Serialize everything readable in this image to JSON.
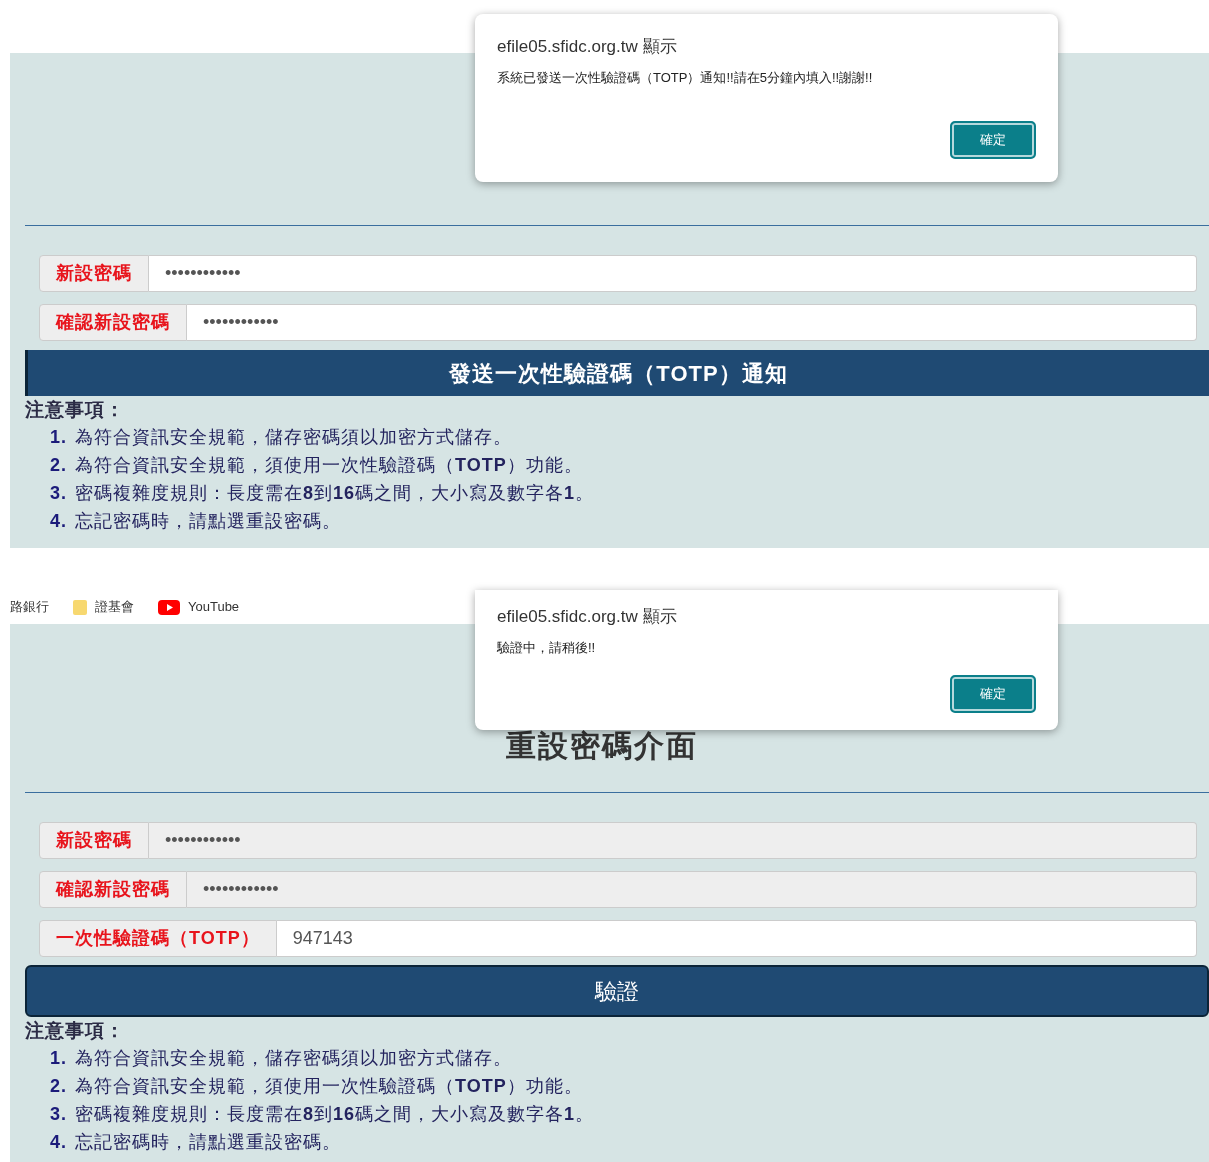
{
  "screenshots": [
    {
      "dialog": {
        "origin": "efile05.sfidc.org.tw 顯示",
        "message": "系統已發送一次性驗證碼（TOTP）通知!!請在5分鐘內填入!!謝謝!!",
        "ok_button": "確定"
      },
      "fields": [
        {
          "label": "新設密碼",
          "value": "••••••••••••",
          "disabled": false
        },
        {
          "label": "確認新設密碼",
          "value": "••••••••••••",
          "disabled": false
        }
      ],
      "action_button": {
        "kind": "send",
        "label": "發送一次性驗證碼（TOTP）通知"
      },
      "notes": {
        "heading": "注意事項：",
        "items": [
          {
            "number": "1.",
            "text": "為符合資訊安全規範，儲存密碼須以加密方式儲存。"
          },
          {
            "number": "2.",
            "text": "為符合資訊安全規範，須使用一次性驗證碼（**TOTP**）功能。"
          },
          {
            "number": "3.",
            "text": "密碼複雜度規則：長度需在**8**到**16**碼之間，大小寫及數字各**1**。"
          },
          {
            "number": "4.",
            "text": "忘記密碼時，請點選重設密碼。"
          }
        ]
      }
    },
    {
      "bookmarks": [
        {
          "kind": "text",
          "label": "路銀行"
        },
        {
          "kind": "folder",
          "label": "證基會"
        },
        {
          "kind": "youtube",
          "label": "YouTube"
        }
      ],
      "dialog": {
        "origin": "efile05.sfidc.org.tw 顯示",
        "message": "驗證中，請稍後!!",
        "ok_button": "確定"
      },
      "title": "重設密碼介面",
      "fields": [
        {
          "label": "新設密碼",
          "value": "••••••••••••",
          "disabled": true
        },
        {
          "label": "確認新設密碼",
          "value": "••••••••••••",
          "disabled": true
        },
        {
          "label": "一次性驗證碼（TOTP）",
          "value": "947143",
          "disabled": false
        }
      ],
      "action_button": {
        "kind": "verify",
        "label": "驗證"
      },
      "notes": {
        "heading": "注意事項：",
        "items": [
          {
            "number": "1.",
            "text": "為符合資訊安全規範，儲存密碼須以加密方式儲存。"
          },
          {
            "number": "2.",
            "text": "為符合資訊安全規範，須使用一次性驗證碼（**TOTP**）功能。"
          },
          {
            "number": "3.",
            "text": "密碼複雜度規則：長度需在**8**到**16**碼之間，大小寫及數字各**1**。"
          },
          {
            "number": "4.",
            "text": "忘記密碼時，請點選重設密碼。"
          }
        ]
      }
    }
  ]
}
